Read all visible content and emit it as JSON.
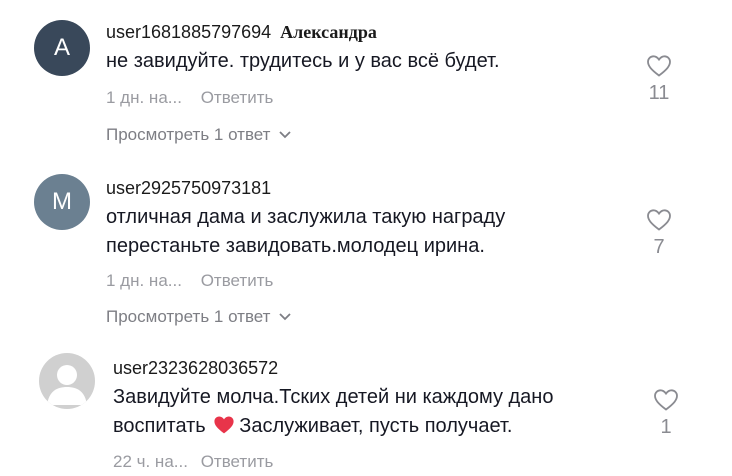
{
  "comments": [
    {
      "avatar_letter": "A",
      "username": "user1681885797694",
      "name_tag": "Александра",
      "text_lines": [
        "не завидуйте. трудитесь и у вас всё будет."
      ],
      "time": "1 дн. на...",
      "reply_label": "Ответить",
      "likes": "11",
      "view_replies": "Просмотреть 1 ответ"
    },
    {
      "avatar_letter": "M",
      "username": "user2925750973181",
      "text_lines": [
        "отличная дама и заслужила такую награду",
        "перестаньте завидовать.молодец ирина."
      ],
      "time": "1 дн. на...",
      "reply_label": "Ответить",
      "likes": "7",
      "view_replies": "Просмотреть 1 ответ"
    },
    {
      "username": "user2323628036572",
      "text_line1": "Завидуйте молча.Тских детей ни каждому дано",
      "text_line2_before": "воспитать",
      "text_line2_after": "Заслуживает, пусть получает.",
      "time": "22 ч. на...",
      "reply_label": "Ответить",
      "likes": "1"
    }
  ],
  "colors": {
    "avatar_a": "#39485a",
    "avatar_m": "#6b8091",
    "heart_emoji": "#e8344a"
  }
}
